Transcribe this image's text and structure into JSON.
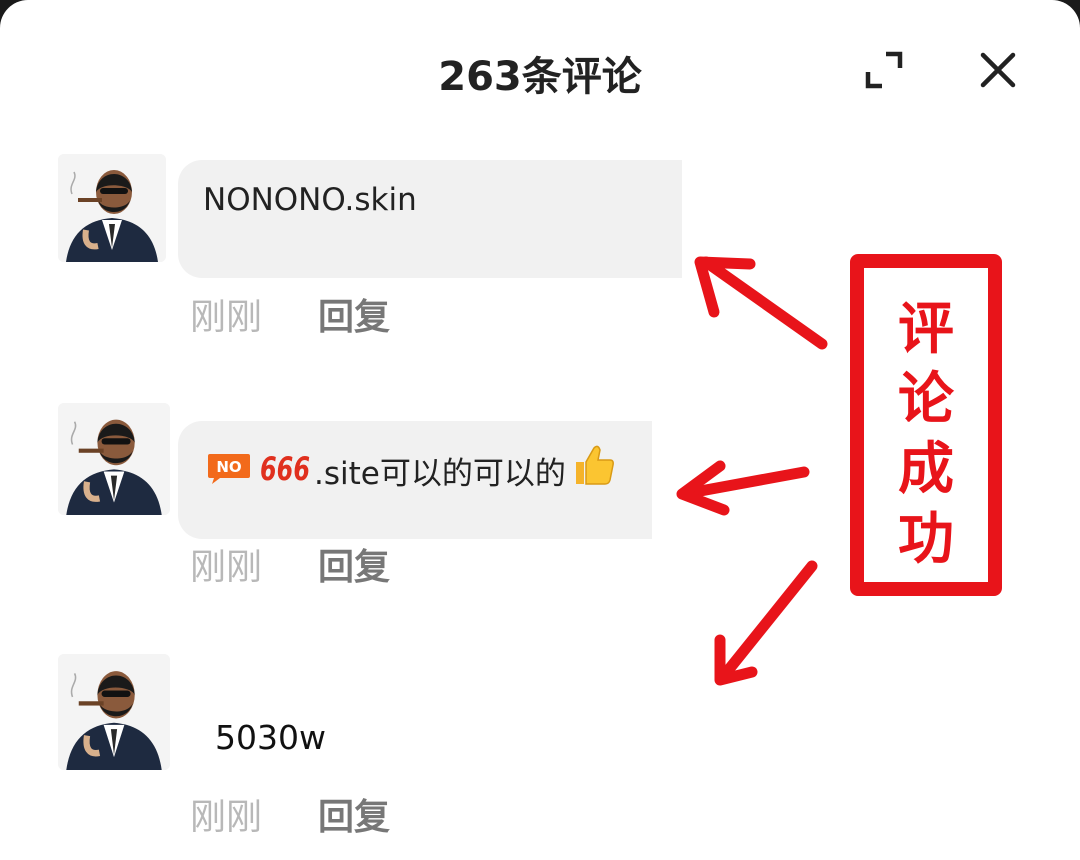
{
  "header": {
    "title": "263条评论"
  },
  "comments": [
    {
      "text": "NONONO.skin",
      "time": "刚刚",
      "reply_label": "回复"
    },
    {
      "badge_no": "NO",
      "badge_666": "666",
      "text": ".site可以的可以的",
      "emoji": "thumbs-up",
      "time": "刚刚",
      "reply_label": "回复"
    },
    {
      "text": "5030w",
      "time": "刚刚",
      "reply_label": "回复"
    }
  ],
  "annotation": {
    "label_chars": [
      "评",
      "论",
      "成",
      "功"
    ],
    "color": "#e8141a"
  },
  "colors": {
    "bubble_bg": "#f1f1f1",
    "meta_text": "#b8b8b8",
    "reply_text": "#777777"
  }
}
